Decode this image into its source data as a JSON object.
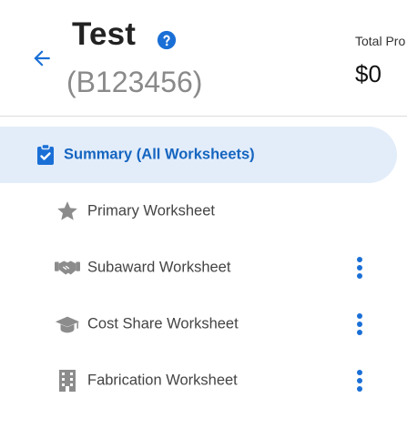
{
  "header": {
    "title": "Test",
    "subtitle": "(B123456)",
    "total_label": "Total Pro",
    "total_value": "$0"
  },
  "colors": {
    "accent": "#1a6fd6",
    "active_bg": "#e3edfa",
    "icon_gray": "#8c8c8c"
  },
  "worksheets": [
    {
      "label": "Summary (All Worksheets)",
      "icon": "clipboard-check-icon",
      "active": true,
      "has_menu": false
    },
    {
      "label": "Primary Worksheet",
      "icon": "star-icon",
      "active": false,
      "has_menu": false
    },
    {
      "label": "Subaward Worksheet",
      "icon": "handshake-icon",
      "active": false,
      "has_menu": true
    },
    {
      "label": "Cost Share Worksheet",
      "icon": "graduation-cap-icon",
      "active": false,
      "has_menu": true
    },
    {
      "label": "Fabrication Worksheet",
      "icon": "building-icon",
      "active": false,
      "has_menu": true
    }
  ]
}
